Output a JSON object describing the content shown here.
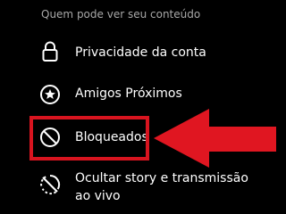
{
  "section": {
    "title": "Quem pode ver seu conteúdo"
  },
  "items": [
    {
      "label": "Privacidade da conta",
      "icon": "lock-icon"
    },
    {
      "label": "Amigos Próximos",
      "icon": "star-circle-icon"
    },
    {
      "label": "Bloqueados",
      "icon": "blocked-icon"
    },
    {
      "label": "Ocultar story e transmissão ao vivo",
      "icon": "hide-story-icon"
    }
  ],
  "annotation": {
    "highlight_color": "#d8141f",
    "arrow_color": "#e01621"
  },
  "colors": {
    "background": "#000000",
    "text": "#ffffff",
    "section_text": "#a8a8a8"
  }
}
